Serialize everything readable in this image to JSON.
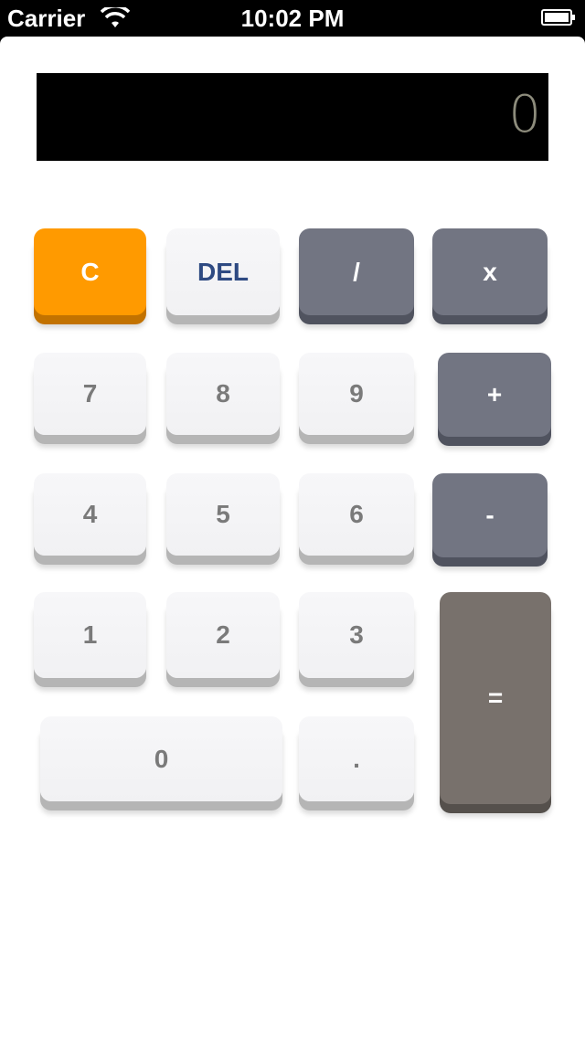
{
  "status_bar": {
    "carrier": "Carrier",
    "time": "10:02 PM",
    "wifi_icon": "wifi-icon",
    "battery_icon": "battery-icon"
  },
  "display": {
    "value": "0"
  },
  "keys": {
    "clear": "C",
    "delete": "DEL",
    "divide": "/",
    "multiply": "x",
    "seven": "7",
    "eight": "8",
    "nine": "9",
    "plus": "+",
    "four": "4",
    "five": "5",
    "six": "6",
    "minus": "-",
    "one": "1",
    "two": "2",
    "three": "3",
    "equals": "=",
    "zero": "0",
    "decimal": "."
  },
  "colors": {
    "clear_key": "#ff9a00",
    "operator_key": "#727582",
    "digit_key": "#f3f3f5",
    "equals_key": "#78716c",
    "delete_text": "#2e4a82",
    "display_background": "#000000",
    "display_text": "#8d8c7c"
  }
}
